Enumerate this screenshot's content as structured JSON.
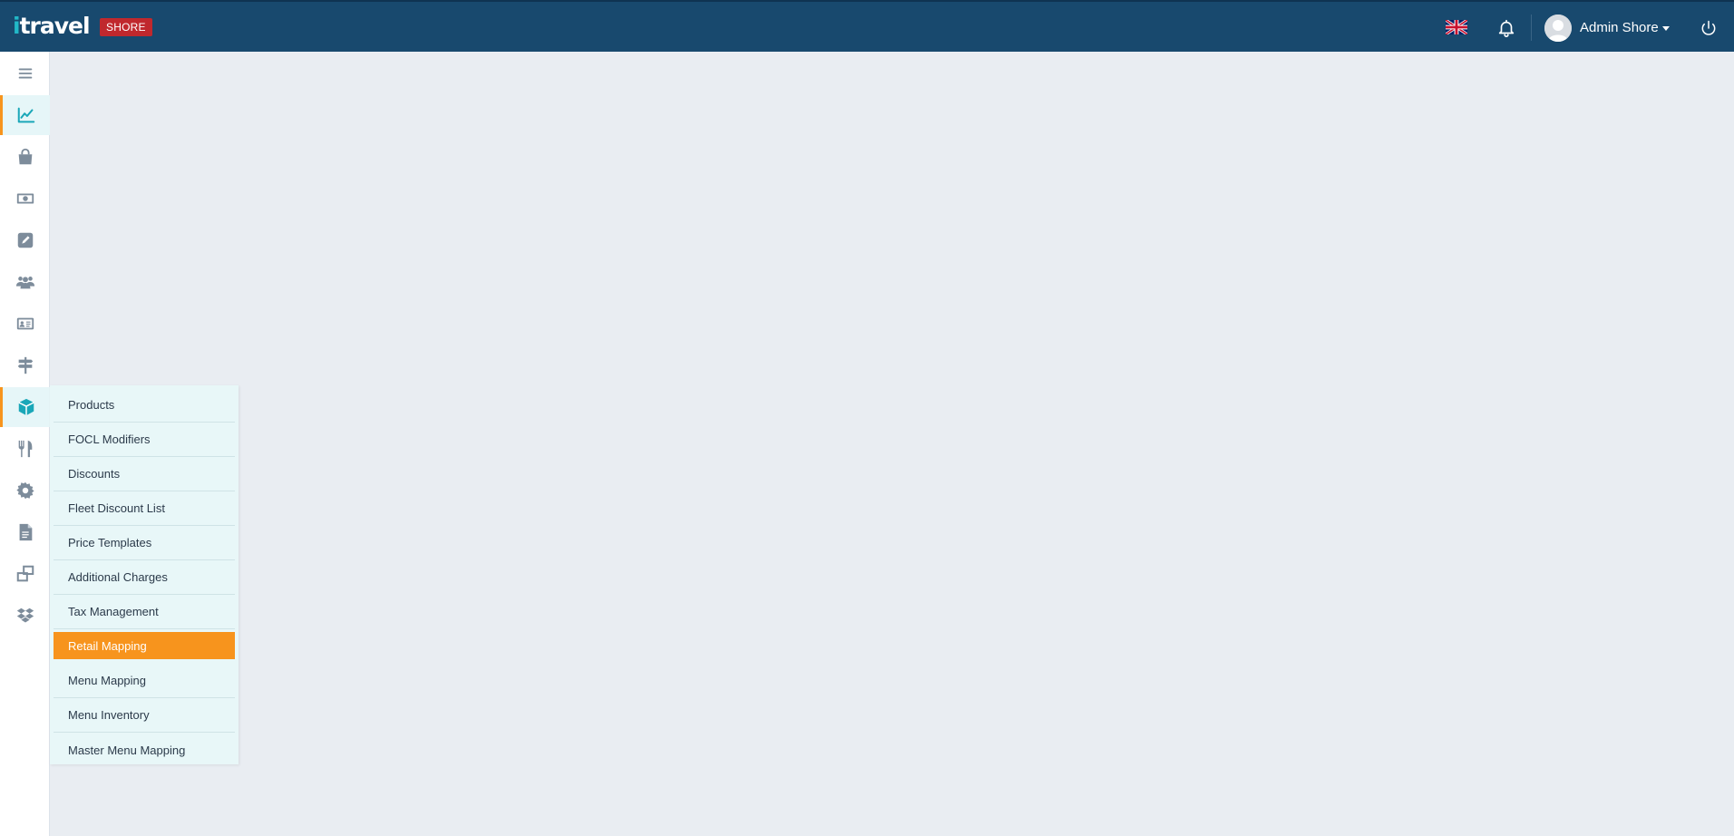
{
  "header": {
    "logo_prefix": "i",
    "logo_rest": "travel",
    "environment_badge": "SHORE",
    "user_name": "Admin Shore",
    "brand_color": "#18496e",
    "badge_color": "#c0282d"
  },
  "sidebar": {
    "items": [
      {
        "icon": "menu-icon"
      },
      {
        "icon": "chart-line-icon",
        "active": true
      },
      {
        "icon": "shopping-bag-icon"
      },
      {
        "icon": "money-bill-icon"
      },
      {
        "icon": "pencil-square-icon"
      },
      {
        "icon": "users-icon"
      },
      {
        "icon": "id-card-icon"
      },
      {
        "icon": "signpost-icon"
      },
      {
        "icon": "cube-icon",
        "active": true
      },
      {
        "icon": "utensils-icon"
      },
      {
        "icon": "gear-icon"
      },
      {
        "icon": "file-icon"
      },
      {
        "icon": "windows-restore-icon"
      },
      {
        "icon": "dropbox-icon"
      }
    ]
  },
  "submenu": {
    "items": [
      {
        "label": "Products"
      },
      {
        "label": "FOCL Modifiers"
      },
      {
        "label": "Discounts"
      },
      {
        "label": "Fleet Discount List"
      },
      {
        "label": "Price Templates"
      },
      {
        "label": "Additional Charges"
      },
      {
        "label": "Tax Management"
      },
      {
        "label": "Retail Mapping",
        "selected": true
      },
      {
        "label": "Menu Mapping"
      },
      {
        "label": "Menu Inventory"
      },
      {
        "label": "Master Menu Mapping"
      }
    ],
    "accent_color": "#f7941d"
  }
}
